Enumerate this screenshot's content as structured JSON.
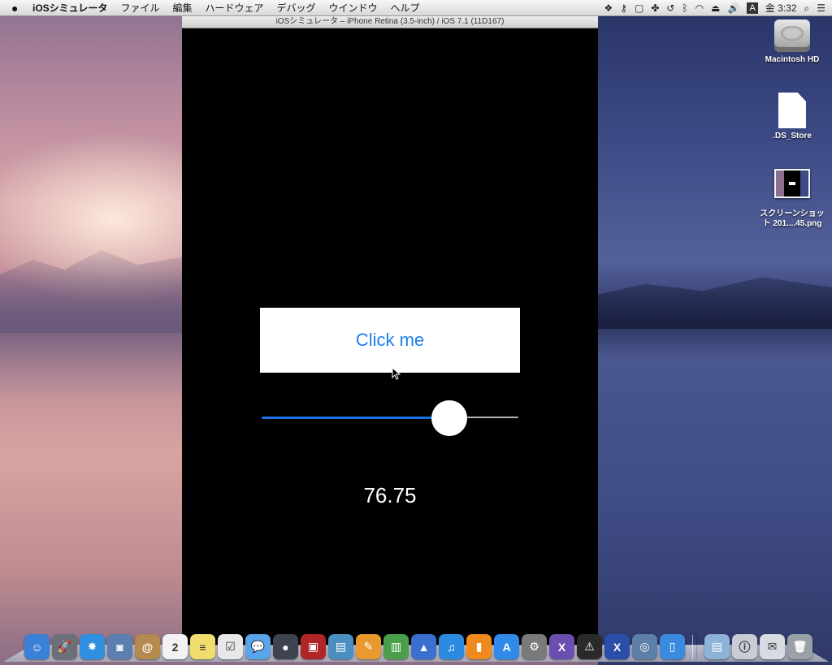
{
  "menubar": {
    "apple_icon": "apple-icon",
    "items": [
      {
        "label": "iOSシミュレータ",
        "bold": true
      },
      {
        "label": "ファイル"
      },
      {
        "label": "編集"
      },
      {
        "label": "ハードウェア"
      },
      {
        "label": "デバッグ"
      },
      {
        "label": "ウインドウ"
      },
      {
        "label": "ヘルプ"
      }
    ],
    "clock": "金 3:32",
    "input_source": "A"
  },
  "simulator": {
    "window_title": "iOSシミュレータ – iPhone Retina (3.5-inch) / iOS 7.1 (11D167)",
    "button_label": "Click me",
    "slider_value": 0.7675,
    "value_label": "76.75",
    "accent_color": "#1e7ef0"
  },
  "desktop": {
    "icons": [
      {
        "label": "Macintosh HD",
        "icon": "hard-drive-icon"
      },
      {
        "label": ".DS_Store",
        "icon": "document-icon"
      },
      {
        "label_line1": "スクリーンショッ",
        "label_line2": "ト 201....45.png",
        "icon": "screenshot-thumbnail-icon"
      }
    ]
  },
  "dock": {
    "items": [
      {
        "name": "finder-icon",
        "color": "#3a7fd8",
        "glyph": "☺"
      },
      {
        "name": "launchpad-icon",
        "color": "#6b6f78",
        "glyph": "🚀"
      },
      {
        "name": "safari-icon",
        "color": "#2f8fe0",
        "glyph": "✸"
      },
      {
        "name": "preview-icon",
        "color": "#5b7fb0",
        "glyph": "◙"
      },
      {
        "name": "contacts-icon",
        "color": "#b48a4e",
        "glyph": "@"
      },
      {
        "name": "calendar-icon",
        "color": "#f2f2f2",
        "glyph": "2"
      },
      {
        "name": "notes-icon",
        "color": "#f0dd6c",
        "glyph": "≡"
      },
      {
        "name": "reminders-icon",
        "color": "#e8e8e8",
        "glyph": "☑"
      },
      {
        "name": "messages-icon",
        "color": "#5aa4ea",
        "glyph": "💬"
      },
      {
        "name": "facetime-icon",
        "color": "#3d4450",
        "glyph": "●"
      },
      {
        "name": "photo-booth-icon",
        "color": "#b02525",
        "glyph": "▣"
      },
      {
        "name": "iphoto-icon",
        "color": "#4a8fc0",
        "glyph": "▤"
      },
      {
        "name": "pages-icon",
        "color": "#e89a2e",
        "glyph": "✎"
      },
      {
        "name": "numbers-icon",
        "color": "#4aa04a",
        "glyph": "▥"
      },
      {
        "name": "keynote-icon",
        "color": "#3a6fd0",
        "glyph": "▲"
      },
      {
        "name": "itunes-icon",
        "color": "#2c8ae0",
        "glyph": "♫"
      },
      {
        "name": "ibooks-icon",
        "color": "#f08a1c",
        "glyph": "▮"
      },
      {
        "name": "app-store-icon",
        "color": "#2f8ae8",
        "glyph": "A"
      },
      {
        "name": "system-preferences-icon",
        "color": "#7a7a7a",
        "glyph": "⚙"
      },
      {
        "name": "xamarin-icon",
        "color": "#6a4fb0",
        "glyph": "X"
      },
      {
        "name": "console-icon",
        "color": "#2a2a2a",
        "glyph": "⚠"
      },
      {
        "name": "xamarin-studio-icon",
        "color": "#2b4ea8",
        "glyph": "X"
      },
      {
        "name": "instruments-icon",
        "color": "#5d7fa8",
        "glyph": "◎"
      },
      {
        "name": "ios-simulator-icon",
        "color": "#3a8ae0",
        "glyph": "▯"
      },
      {
        "name": "applications-folder-icon",
        "color": "#8fb2d8",
        "glyph": "▤",
        "after_separator": true
      },
      {
        "name": "documents-folder-icon",
        "color": "#c8ccd4",
        "glyph": "ⓘ"
      },
      {
        "name": "downloads-folder-icon",
        "color": "#d8dce2",
        "glyph": "✉"
      },
      {
        "name": "trash-icon",
        "color": "#9aa0a8",
        "glyph": "🗑"
      }
    ]
  }
}
